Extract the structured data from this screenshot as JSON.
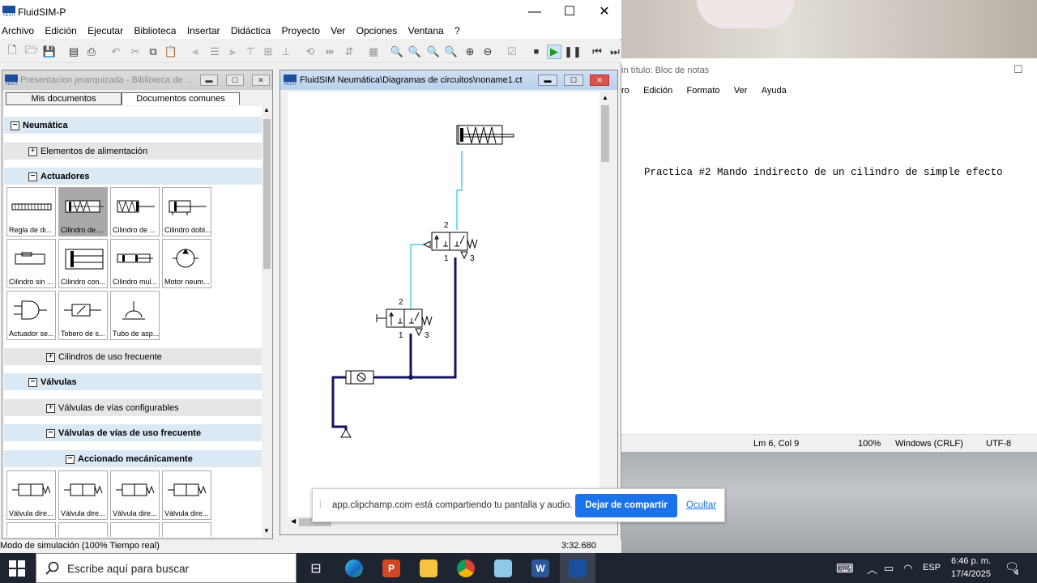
{
  "fluidsim": {
    "app_title": "FluidSIM-P",
    "menu": [
      "Archivo",
      "Edición",
      "Ejecutar",
      "Biblioteca",
      "Insertar",
      "Didáctica",
      "Proyecto",
      "Ver",
      "Opciones",
      "Ventana",
      "?"
    ],
    "status_left": "Modo de simulación (100% Tiempo real)",
    "status_right": "3:32.680"
  },
  "library": {
    "title": "Presentacion jerarquizada - Biblioteca de ...",
    "tabs": [
      "Mis documentos",
      "Documentos comunes"
    ],
    "rows": {
      "neumatica": "Neumática",
      "alimentacion": "Elementos de alimentación",
      "actuadores": "Actuadores",
      "cilindros": "Cilindros de uso frecuente",
      "valvulas": "Válvulas",
      "configurables": "Válvulas de vías configurables",
      "frecuente": "Válvulas de vías de uso frecuente",
      "mecanicamente": "Accionado mecánicamente"
    },
    "tiles": [
      "Regla de di...",
      "Cilindro de ...",
      "Cilindro de ...",
      "Cilindro dobl...",
      "Cilindro sin ...",
      "Cilindro con...",
      "Cilindro mul...",
      "Motor neum...",
      "Actuador se...",
      "Tobero de s...",
      "Tubo de asp...",
      "Válvula dire...",
      "Válvula dire...",
      "Válvula dire...",
      "Válvula dire..."
    ]
  },
  "circuit": {
    "title": "FluidSIM Neumática\\Diagramas de circuitos\\noname1.ct",
    "port_labels": [
      "2",
      "1",
      "3",
      "2",
      "1",
      "3"
    ]
  },
  "notepad": {
    "title": "in título: Bloc de notas",
    "menu": [
      "ro",
      "Edición",
      "Formato",
      "Ver",
      "Ayuda"
    ],
    "text": "Practica #2 Mando indirecto de un cilindro de simple efecto",
    "status": [
      "Lm 6, Col 9",
      "100%",
      "Windows (CRLF)",
      "UTF-8"
    ]
  },
  "share": {
    "message": "app.clipchamp.com está compartiendo tu pantalla y audio.",
    "stop_label": "Dejar de compartir",
    "hide_label": "Ocultar"
  },
  "taskbar": {
    "search_placeholder": "Escribe aquí para buscar",
    "lang": "ESP",
    "time": "6:46 p. m.",
    "date": "17/4/2025",
    "notif_count": "4"
  }
}
